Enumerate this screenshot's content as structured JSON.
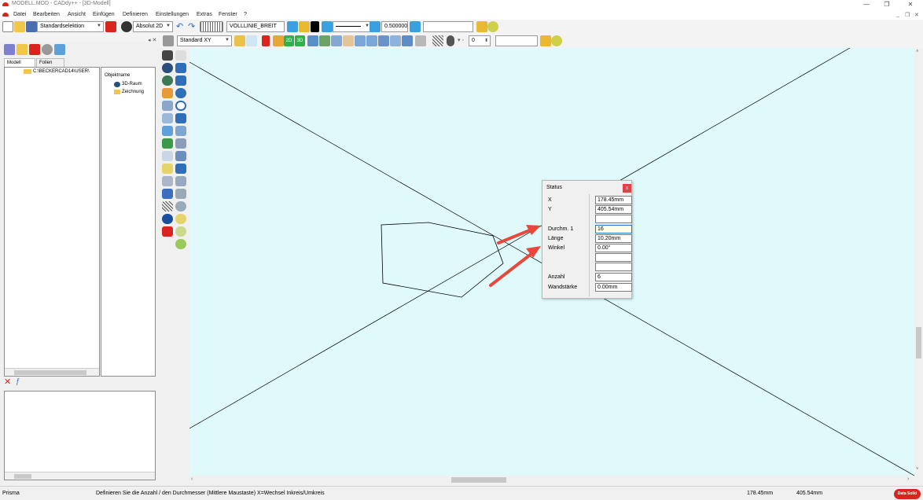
{
  "titlebar": {
    "title": "MODELL.MOD  -  CADdy++ - [3D-Modell]",
    "minimize": "—",
    "restore": "❐",
    "close": "✕"
  },
  "menu": {
    "items": [
      "Datei",
      "Bearbeiten",
      "Ansicht",
      "Einfügen",
      "Definieren",
      "Einstellungen",
      "Extras",
      "Fenster",
      "?"
    ],
    "mdi_min": "_",
    "mdi_restore": "❐",
    "mdi_close": "✕"
  },
  "toolbar1": {
    "selection_mode": "Standardselektion",
    "coord_mode": "Absolut 2D",
    "linetype": "VOLLLINIE_BREIT",
    "line_width": "0.500000",
    "layer_value": ""
  },
  "toolbar2": {
    "view": "Standard XY",
    "number_value": "0",
    "extra_value": ""
  },
  "leftpanel": {
    "tabs": [
      "Modell",
      "Folien"
    ],
    "tree_item": "C:\\BECKERCAD14\\USER\\",
    "objlist_header": "Objektname",
    "objlist_items": [
      "3D-Raum",
      "Zeichnung"
    ]
  },
  "dialog": {
    "title": "Status",
    "close": "x",
    "labels": {
      "x": "X",
      "y": "Y",
      "diameter": "Durchm. 1",
      "length": "Länge",
      "angle": "Winkel",
      "count": "Anzahl",
      "wall": "Wandstärke"
    },
    "values": {
      "x": "178.45mm",
      "y": "405.54mm",
      "diameter": "16",
      "length": "10.20mm",
      "angle": "0.00°",
      "count": "6",
      "wall": "0.00mm"
    }
  },
  "statusbar": {
    "command": "Prisma",
    "hint": "Definieren Sie die Anzahl / den Durchmesser (Mittlere Maustaste) X=Wechsel Inkreis/Umkreis",
    "coord_x": "178.45mm",
    "coord_y": "405.54mm",
    "logo": "Data Solid"
  },
  "colors": {
    "canvas_bg": "#e0fafb",
    "annotation_arrow": "#e8473b",
    "app_red": "#d9251d"
  }
}
